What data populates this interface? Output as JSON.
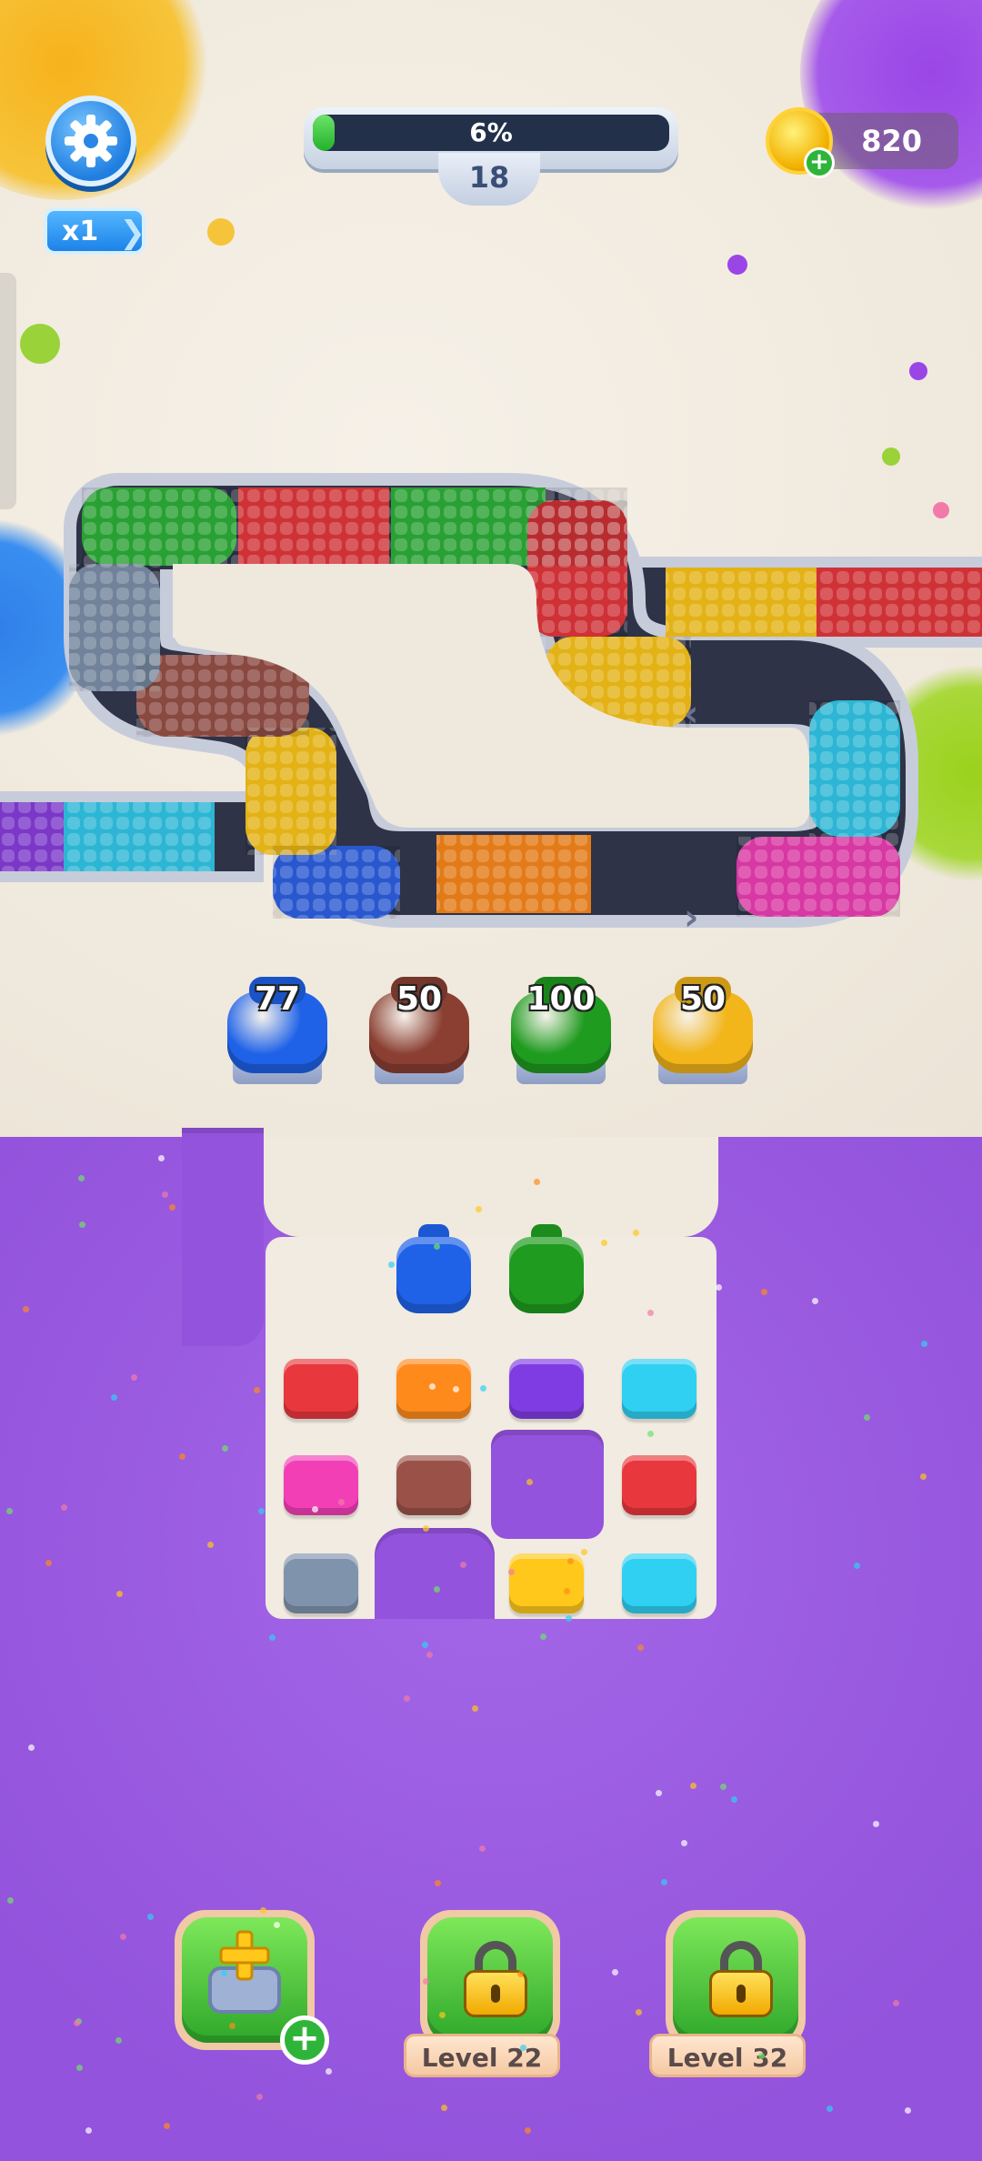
{
  "hud": {
    "speed_label": "x1",
    "progress_fraction": 0.06,
    "progress_text": "6%",
    "level_number": "18",
    "coins": "820"
  },
  "jars": [
    {
      "count": "77",
      "color": "#1f62e8"
    },
    {
      "count": "50",
      "color": "#8a3f32"
    },
    {
      "count": "100",
      "color": "#1f9b1f"
    },
    {
      "count": "50",
      "color": "#f2b51a"
    }
  ],
  "cups_waiting": [
    {
      "color": "#1f62e8"
    },
    {
      "color": "#1f9b1f"
    }
  ],
  "grid_blocks": [
    {
      "name": "red",
      "color": "#e8383d"
    },
    {
      "name": "orange",
      "color": "#ff8a1c"
    },
    {
      "name": "purple",
      "color": "#7f3ce3"
    },
    {
      "name": "cyan",
      "color": "#2fd0f2"
    },
    {
      "name": "pink",
      "color": "#f23fb6"
    },
    {
      "name": "brown",
      "color": "#9a5248"
    },
    {
      "name": "red",
      "color": "#e8383d"
    },
    {
      "name": "slate",
      "color": "#7f93ad"
    },
    {
      "name": "yellow",
      "color": "#ffc81a"
    },
    {
      "name": "cyan",
      "color": "#2fd0f2"
    }
  ],
  "boosters": [
    {
      "id": "add-slot",
      "locked": false
    },
    {
      "id": "booster-2",
      "locked": true,
      "label": "Level 22"
    },
    {
      "id": "booster-3",
      "locked": true,
      "label": "Level 32"
    }
  ],
  "colors": {
    "track_red": "#e8383d",
    "track_green": "#2fb43a",
    "track_yellow": "#ffc81a",
    "track_blue": "#2f63e8",
    "track_orange": "#ff8a1c",
    "track_pink": "#f23fb6",
    "track_cyan": "#33ccee",
    "track_slate": "#7f93ad",
    "track_brown": "#9a5248",
    "track_purple": "#8a3fe0"
  }
}
